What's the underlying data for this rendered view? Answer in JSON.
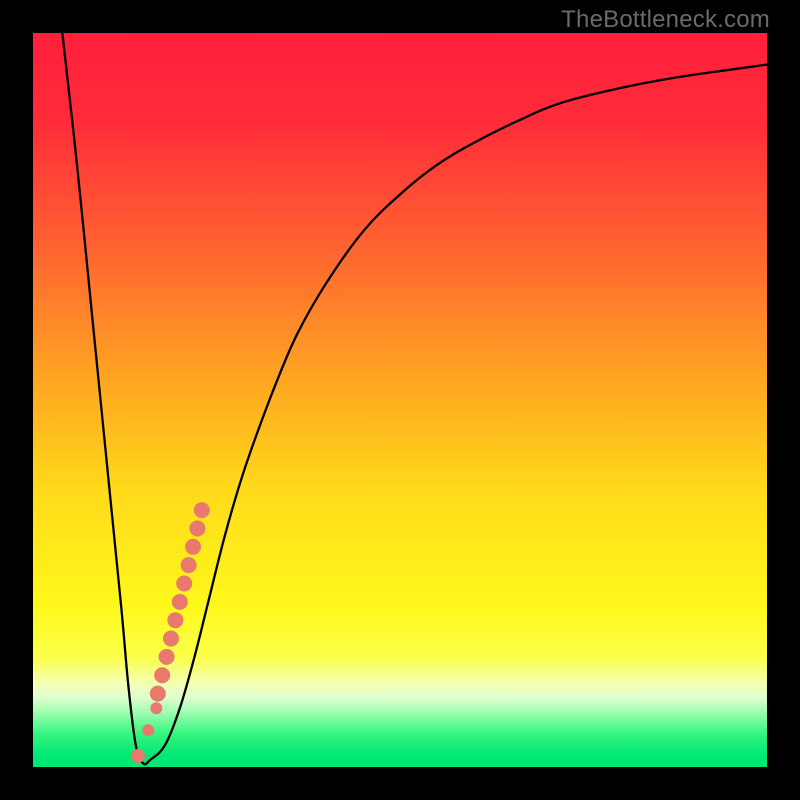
{
  "watermark": "TheBottleneck.com",
  "chart_data": {
    "type": "line",
    "title": "",
    "xlabel": "",
    "ylabel": "",
    "xlim": [
      0,
      100
    ],
    "ylim": [
      0,
      100
    ],
    "grid": false,
    "series": [
      {
        "name": "bottleneck-curve",
        "x": [
          4,
          6,
          8,
          10,
          12,
          13,
          14,
          15,
          16,
          18,
          20,
          22,
          24,
          26,
          28,
          30,
          33,
          36,
          40,
          45,
          50,
          55,
          60,
          66,
          72,
          80,
          88,
          95,
          100
        ],
        "y": [
          100,
          82,
          62,
          42,
          22,
          11,
          3,
          0.5,
          1,
          3,
          8,
          15,
          23,
          31,
          38,
          44,
          52,
          59,
          66,
          73,
          78,
          82,
          85,
          88,
          90.5,
          92.5,
          94,
          95,
          95.7
        ]
      }
    ],
    "marker_band": {
      "name": "salmon-dots",
      "color": "#e8796c",
      "points": [
        {
          "x": 14.3,
          "y": 1.5,
          "r": 7
        },
        {
          "x": 15.7,
          "y": 5.0,
          "r": 6
        },
        {
          "x": 16.8,
          "y": 8.0,
          "r": 6
        },
        {
          "x": 17.0,
          "y": 10.0,
          "r": 8
        },
        {
          "x": 17.6,
          "y": 12.5,
          "r": 8
        },
        {
          "x": 18.2,
          "y": 15.0,
          "r": 8
        },
        {
          "x": 18.8,
          "y": 17.5,
          "r": 8
        },
        {
          "x": 19.4,
          "y": 20.0,
          "r": 8
        },
        {
          "x": 20.0,
          "y": 22.5,
          "r": 8
        },
        {
          "x": 20.6,
          "y": 25.0,
          "r": 8
        },
        {
          "x": 21.2,
          "y": 27.5,
          "r": 8
        },
        {
          "x": 21.8,
          "y": 30.0,
          "r": 8
        },
        {
          "x": 22.4,
          "y": 32.5,
          "r": 8
        },
        {
          "x": 23.0,
          "y": 35.0,
          "r": 8
        }
      ]
    },
    "gradient_stops": [
      {
        "offset": 0.0,
        "color": "#ff1f3b"
      },
      {
        "offset": 0.12,
        "color": "#ff2b3a"
      },
      {
        "offset": 0.3,
        "color": "#ff6630"
      },
      {
        "offset": 0.48,
        "color": "#ffa821"
      },
      {
        "offset": 0.62,
        "color": "#ffd91a"
      },
      {
        "offset": 0.78,
        "color": "#fff81c"
      },
      {
        "offset": 0.85,
        "color": "#fbff4a"
      },
      {
        "offset": 0.885,
        "color": "#f4ffb0"
      },
      {
        "offset": 0.905,
        "color": "#dfffcf"
      },
      {
        "offset": 0.925,
        "color": "#9fffb0"
      },
      {
        "offset": 0.955,
        "color": "#34f57f"
      },
      {
        "offset": 0.985,
        "color": "#00e874"
      },
      {
        "offset": 1.0,
        "color": "#00e874"
      }
    ]
  }
}
